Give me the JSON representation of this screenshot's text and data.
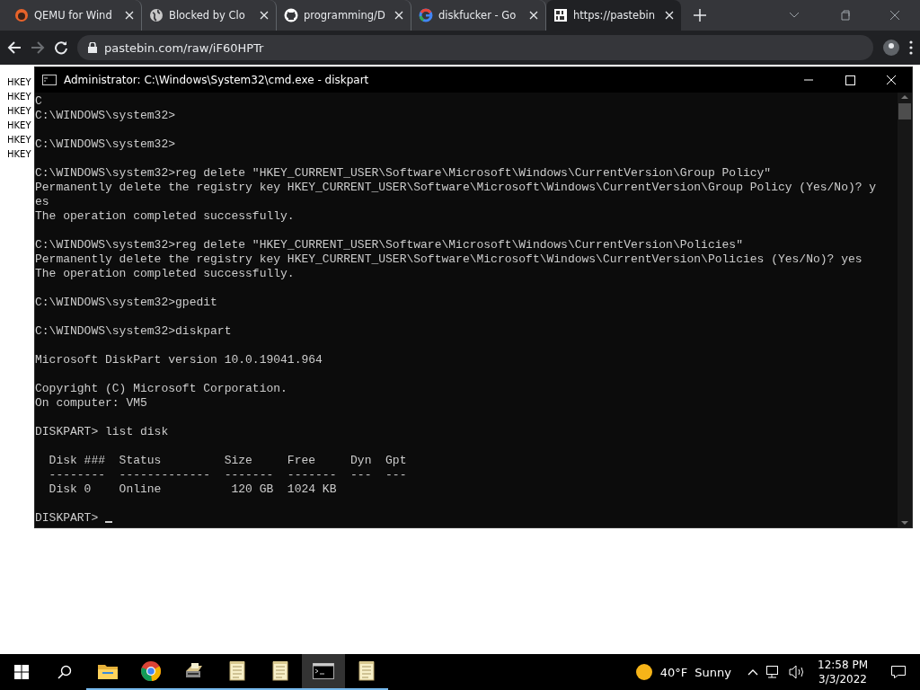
{
  "browser": {
    "tabs": [
      {
        "title": "QEMU for Wind",
        "selected": false
      },
      {
        "title": "Blocked by Clo",
        "selected": false
      },
      {
        "title": "programming/D",
        "selected": false
      },
      {
        "title": "diskfucker - Go",
        "selected": false
      },
      {
        "title": "https://pastebin",
        "selected": true
      }
    ],
    "address": "pastebin.com/raw/iF60HPTr"
  },
  "page_lines": [
    "HKEY",
    "HKEY",
    "HKEY",
    "HKEY",
    "HKEY",
    "HKEY"
  ],
  "console": {
    "title": "Administrator: C:\\Windows\\System32\\cmd.exe - diskpart",
    "blocks": [
      [
        "C",
        "C:\\WINDOWS\\system32>"
      ],
      [
        "C:\\WINDOWS\\system32>"
      ],
      [
        "C:\\WINDOWS\\system32>reg delete \"HKEY_CURRENT_USER\\Software\\Microsoft\\Windows\\CurrentVersion\\Group Policy\"",
        "Permanently delete the registry key HKEY_CURRENT_USER\\Software\\Microsoft\\Windows\\CurrentVersion\\Group Policy (Yes/No)? y",
        "es",
        "The operation completed successfully."
      ],
      [
        "C:\\WINDOWS\\system32>reg delete \"HKEY_CURRENT_USER\\Software\\Microsoft\\Windows\\CurrentVersion\\Policies\"",
        "Permanently delete the registry key HKEY_CURRENT_USER\\Software\\Microsoft\\Windows\\CurrentVersion\\Policies (Yes/No)? yes",
        "The operation completed successfully."
      ],
      [
        "C:\\WINDOWS\\system32>gpedit"
      ],
      [
        "C:\\WINDOWS\\system32>diskpart"
      ],
      [
        "Microsoft DiskPart version 10.0.19041.964"
      ],
      [
        "Copyright (C) Microsoft Corporation.",
        "On computer: VM5"
      ],
      [
        "DISKPART> list disk"
      ],
      [
        "  Disk ###  Status         Size     Free     Dyn  Gpt",
        "  --------  -------------  -------  -------  ---  ---",
        "  Disk 0    Online          120 GB  1024 KB"
      ],
      [
        "DISKPART> "
      ]
    ]
  },
  "taskbar": {
    "apps": [
      {
        "selected": false
      },
      {
        "selected": false
      },
      {
        "selected": false
      },
      {
        "selected": false
      },
      {
        "selected": false
      },
      {
        "selected": true
      },
      {
        "selected": false
      }
    ],
    "temperature": "40°F",
    "weather": "Sunny",
    "time": "12:58 PM",
    "date": "3/3/2022"
  }
}
